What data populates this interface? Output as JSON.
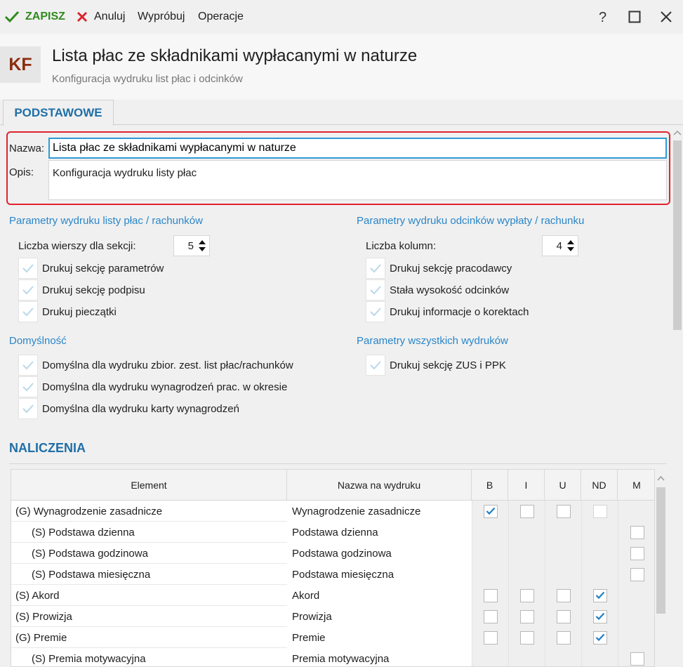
{
  "toolbar": {
    "save_label": "ZAPISZ",
    "cancel_label": "Anuluj",
    "try_label": "Wypróbuj",
    "operations_label": "Operacje"
  },
  "header": {
    "badge": "KF",
    "title": "Lista płac ze składnikami wypłacanymi w naturze",
    "subtitle": "Konfiguracja wydruku list płac i odcinków"
  },
  "tabs": [
    {
      "label": "PODSTAWOWE",
      "active": true
    }
  ],
  "form": {
    "name_label": "Nazwa:",
    "name_value": "Lista płac ze składnikami wypłacanymi w naturze",
    "desc_label": "Opis:",
    "desc_value": "Konfiguracja wydruku listy płac"
  },
  "payroll_params": {
    "heading": "Parametry wydruku listy płac / rachunków",
    "rows_label": "Liczba wierszy dla sekcji:",
    "rows_value": "5",
    "checks": [
      {
        "label": "Drukuj sekcję parametrów",
        "checked": true
      },
      {
        "label": "Drukuj sekcję podpisu",
        "checked": true
      },
      {
        "label": "Drukuj pieczątki",
        "checked": true
      }
    ]
  },
  "slip_params": {
    "heading": "Parametry wydruku odcinków wypłaty / rachunku",
    "cols_label": "Liczba kolumn:",
    "cols_value": "4",
    "checks": [
      {
        "label": "Drukuj sekcję pracodawcy",
        "checked": true
      },
      {
        "label": "Stała wysokość odcinków",
        "checked": true
      },
      {
        "label": "Drukuj informacje o korektach",
        "checked": true
      }
    ]
  },
  "defaults": {
    "heading": "Domyślność",
    "checks": [
      {
        "label": "Domyślna dla wydruku zbior. zest. list płac/rachunków",
        "checked": true
      },
      {
        "label": "Domyślna dla wydruku wynagrodzeń prac. w okresie",
        "checked": true
      },
      {
        "label": "Domyślna dla wydruku karty wynagrodzeń",
        "checked": true
      }
    ]
  },
  "all_params": {
    "heading": "Parametry wszystkich wydruków",
    "checks": [
      {
        "label": "Drukuj sekcję ZUS i PPK",
        "checked": true
      }
    ]
  },
  "naliczenia": {
    "heading": "NALICZENIA",
    "columns": [
      "Element",
      "Nazwa na wydruku",
      "B",
      "I",
      "U",
      "ND",
      "M"
    ],
    "rows": [
      {
        "element": "(G) Wynagrodzenie zasadnicze",
        "indent": false,
        "name": "Wynagrodzenie zasadnicze",
        "B": true,
        "I": false,
        "U": false,
        "ND": false,
        "M": null,
        "nd_grey": true
      },
      {
        "element": "(S) Podstawa dzienna",
        "indent": true,
        "name": "Podstawa dzienna",
        "B": null,
        "I": null,
        "U": null,
        "ND": null,
        "M": false
      },
      {
        "element": "(S) Podstawa godzinowa",
        "indent": true,
        "name": "Podstawa godzinowa",
        "B": null,
        "I": null,
        "U": null,
        "ND": null,
        "M": false
      },
      {
        "element": "(S) Podstawa miesięczna",
        "indent": true,
        "name": "Podstawa miesięczna",
        "B": null,
        "I": null,
        "U": null,
        "ND": null,
        "M": false
      },
      {
        "element": "(S) Akord",
        "indent": false,
        "name": "Akord",
        "B": false,
        "I": false,
        "U": false,
        "ND": true,
        "M": null
      },
      {
        "element": "(S) Prowizja",
        "indent": false,
        "name": "Prowizja",
        "B": false,
        "I": false,
        "U": false,
        "ND": true,
        "M": null
      },
      {
        "element": "(G) Premie",
        "indent": false,
        "name": "Premie",
        "B": false,
        "I": false,
        "U": false,
        "ND": true,
        "M": null
      },
      {
        "element": "(S) Premia motywacyjna",
        "indent": true,
        "name": "Premia motywacyjna",
        "B": null,
        "I": null,
        "U": null,
        "ND": null,
        "M": false
      }
    ]
  },
  "colors": {
    "accent": "#2a86c8",
    "save_green": "#2f8a1e",
    "cancel_red": "#d8262f",
    "highlight": "#e0232f",
    "badge_text": "#8b2d0f"
  }
}
